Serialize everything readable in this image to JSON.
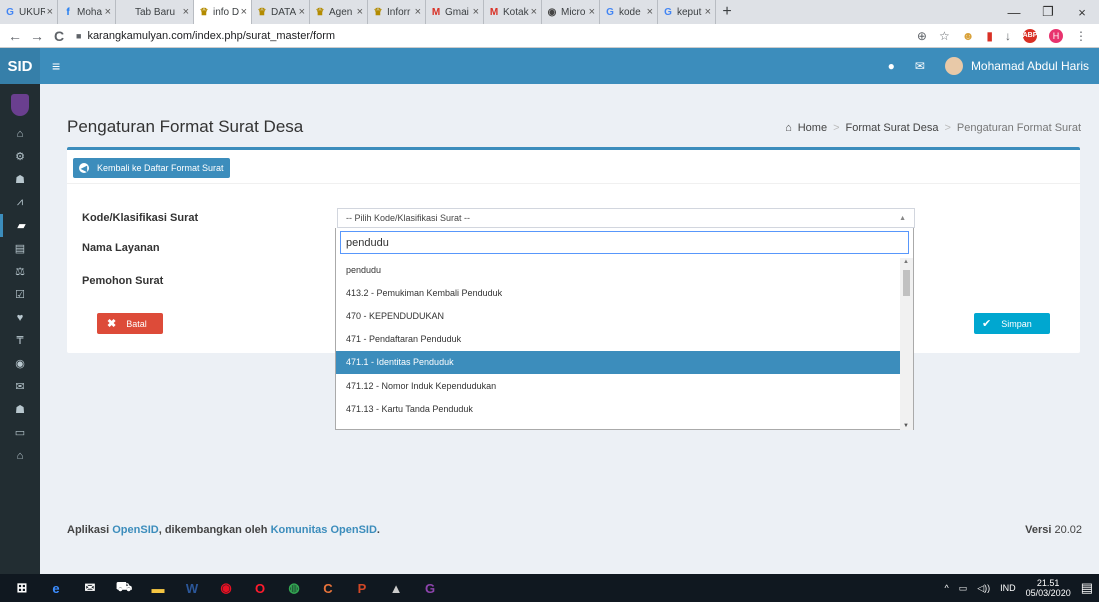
{
  "browser": {
    "tabs": [
      {
        "icon": "G",
        "icon_color": "#4285f4",
        "label": "UKUR"
      },
      {
        "icon": "f",
        "icon_color": "#1877f2",
        "label": "Moha"
      },
      {
        "icon": "",
        "icon_color": "#5f6368",
        "label": "Tab Baru"
      },
      {
        "icon": "♛",
        "icon_color": "#b38b00",
        "label": "info D"
      },
      {
        "icon": "♛",
        "icon_color": "#b38b00",
        "label": "DATA"
      },
      {
        "icon": "♛",
        "icon_color": "#b38b00",
        "label": "Agen"
      },
      {
        "icon": "♛",
        "icon_color": "#b38b00",
        "label": "Inforr"
      },
      {
        "icon": "M",
        "icon_color": "#d93025",
        "label": "Gmai"
      },
      {
        "icon": "M",
        "icon_color": "#d93025",
        "label": "Kotak"
      },
      {
        "icon": "◉",
        "icon_color": "#444444",
        "label": "Micro"
      },
      {
        "icon": "G",
        "icon_color": "#4285f4",
        "label": "kode"
      },
      {
        "icon": "G",
        "icon_color": "#4285f4",
        "label": "keput"
      }
    ],
    "close_glyph": "×",
    "new_tab": "+",
    "window_controls": {
      "minimize": "—",
      "maximize": "❐",
      "close": "×"
    },
    "nav": {
      "back": "←",
      "forward": "→",
      "reload": "C"
    },
    "url": "karangkamulyan.com/index.php/surat_master/form",
    "extensions": {
      "zoom": "⊕",
      "star": "☆",
      "ext1": "☻",
      "ext2": "▮",
      "download": "↓",
      "adblock": "ABP",
      "profile": "H",
      "menu": "⋮"
    }
  },
  "app": {
    "brand": "SID",
    "menu_icon": "≡",
    "header": {
      "chat_icon": "●",
      "mail_icon": "✉",
      "user_name": "Mohamad Abdul Haris"
    }
  },
  "sidebar": {
    "items": [
      {
        "name": "home",
        "glyph": "⌂"
      },
      {
        "name": "identity",
        "glyph": "⚙"
      },
      {
        "name": "population",
        "glyph": "☗"
      },
      {
        "name": "statistics",
        "glyph": "⩘"
      },
      {
        "name": "letters",
        "glyph": "▰",
        "active": true
      },
      {
        "name": "archive",
        "glyph": "▤"
      },
      {
        "name": "legal",
        "glyph": "⚖"
      },
      {
        "name": "analysis",
        "glyph": "☑"
      },
      {
        "name": "aid",
        "glyph": "♥"
      },
      {
        "name": "secretariat",
        "glyph": "₸"
      },
      {
        "name": "location",
        "glyph": "◉"
      },
      {
        "name": "messages",
        "glyph": "✉"
      },
      {
        "name": "groups",
        "glyph": "☗"
      },
      {
        "name": "settings",
        "glyph": "▭"
      },
      {
        "name": "admin",
        "glyph": "⌂"
      }
    ]
  },
  "page": {
    "title": "Pengaturan Format Surat Desa",
    "breadcrumb": {
      "home_icon": "⌂",
      "home": "Home",
      "sep": ">",
      "parent": "Format Surat Desa",
      "current": "Pengaturan Format Surat"
    }
  },
  "form": {
    "back_icon": "◀",
    "back_label": "Kembali ke Daftar Format Surat",
    "labels": {
      "kode": "Kode/Klasifikasi Surat",
      "nama": "Nama Layanan",
      "pemohon": "Pemohon Surat"
    },
    "select_placeholder": "-- Pilih Kode/Klasifikasi Surat --",
    "select_arrow": "▲",
    "search_value": "pendudu",
    "cancel_icon": "✖",
    "cancel_label": "Batal",
    "save_icon": "✔",
    "save_label": "Simpan"
  },
  "dropdown": {
    "options": [
      "pendudu",
      "413.2 - Pemukiman Kembali Penduduk",
      "470 - KEPENDUDUKAN",
      "471 - Pendaftaran Penduduk",
      "471.1 - Identitas Penduduk",
      "471.12 - Nomor Induk Kependudukan",
      "471.13 - Kartu Tanda Penduduk"
    ],
    "selected_index": 4,
    "scroll_up": "▲",
    "scroll_down": "▼"
  },
  "footer": {
    "prefix": "Aplikasi ",
    "app_link": "OpenSID",
    "middle": ", dikembangkan oleh ",
    "community_link": "Komunitas OpenSID",
    "suffix": ".",
    "version_label": "Versi",
    "version_value": "20.02"
  },
  "taskbar": {
    "icons": [
      {
        "name": "start",
        "glyph": "⊞",
        "color": "#ffffff"
      },
      {
        "name": "edge",
        "glyph": "e",
        "color": "#3c8dff"
      },
      {
        "name": "mail",
        "glyph": "✉",
        "color": "#ffffff"
      },
      {
        "name": "store",
        "glyph": "⛟",
        "color": "#ffffff"
      },
      {
        "name": "explorer",
        "glyph": "▬",
        "color": "#f4c542"
      },
      {
        "name": "word",
        "glyph": "W",
        "color": "#2b579a"
      },
      {
        "name": "app-red",
        "glyph": "◉",
        "color": "#e81123"
      },
      {
        "name": "opera",
        "glyph": "O",
        "color": "#ff1b2d"
      },
      {
        "name": "chrome",
        "glyph": "◍",
        "color": "#34a853"
      },
      {
        "name": "ccleaner",
        "glyph": "C",
        "color": "#e8733a"
      },
      {
        "name": "powerpoint",
        "glyph": "P",
        "color": "#d24726"
      },
      {
        "name": "photos",
        "glyph": "▲",
        "color": "#cccccc"
      },
      {
        "name": "app-g",
        "glyph": "G",
        "color": "#8e44ad"
      }
    ],
    "tray": {
      "up_arrow": "^",
      "network": "▭",
      "volume": "◁))",
      "lang": "IND",
      "time": "21.51",
      "date": "05/03/2020",
      "notif": "▤"
    }
  }
}
